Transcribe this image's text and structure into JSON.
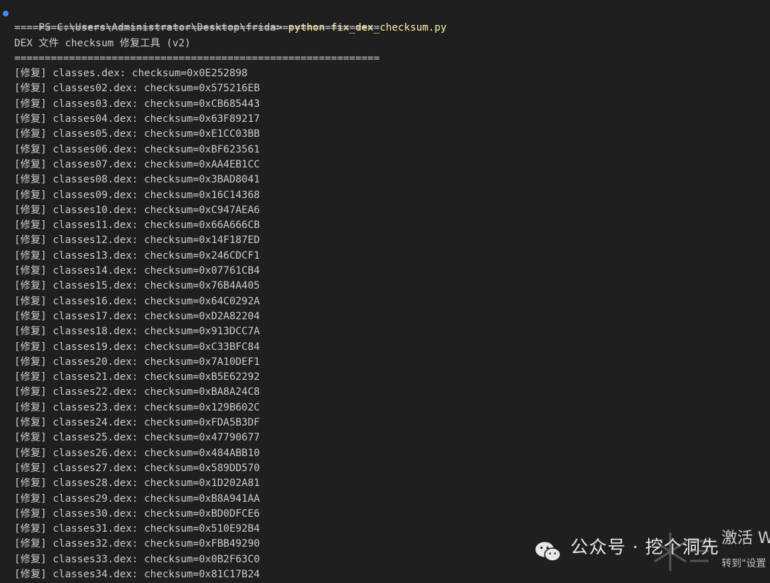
{
  "terminal": {
    "prompt": "PS C:\\Users\\Administrator\\Desktop\\frida> ",
    "command": "python fix_dex_checksum.py",
    "separator": "============================================================",
    "header": "DEX 文件 checksum 修复工具 (v2)",
    "entries": [
      {
        "tag": "[修复]",
        "text": " classes.dex: checksum=0x0E252898"
      },
      {
        "tag": "[修复]",
        "text": " classes02.dex: checksum=0x575216EB"
      },
      {
        "tag": "[修复]",
        "text": " classes03.dex: checksum=0xCB685443"
      },
      {
        "tag": "[修复]",
        "text": " classes04.dex: checksum=0x63F89217"
      },
      {
        "tag": "[修复]",
        "text": " classes05.dex: checksum=0xE1CC03BB"
      },
      {
        "tag": "[修复]",
        "text": " classes06.dex: checksum=0xBF623561"
      },
      {
        "tag": "[修复]",
        "text": " classes07.dex: checksum=0xAA4EB1CC"
      },
      {
        "tag": "[修复]",
        "text": " classes08.dex: checksum=0x3BAD8041"
      },
      {
        "tag": "[修复]",
        "text": " classes09.dex: checksum=0x16C14368"
      },
      {
        "tag": "[修复]",
        "text": " classes10.dex: checksum=0xC947AEA6"
      },
      {
        "tag": "[修复]",
        "text": " classes11.dex: checksum=0x66A666CB"
      },
      {
        "tag": "[修复]",
        "text": " classes12.dex: checksum=0x14F187ED"
      },
      {
        "tag": "[修复]",
        "text": " classes13.dex: checksum=0x246CDCF1"
      },
      {
        "tag": "[修复]",
        "text": " classes14.dex: checksum=0x07761CB4"
      },
      {
        "tag": "[修复]",
        "text": " classes15.dex: checksum=0x76B4A405"
      },
      {
        "tag": "[修复]",
        "text": " classes16.dex: checksum=0x64C0292A"
      },
      {
        "tag": "[修复]",
        "text": " classes17.dex: checksum=0xD2A82204"
      },
      {
        "tag": "[修复]",
        "text": " classes18.dex: checksum=0x913DCC7A"
      },
      {
        "tag": "[修复]",
        "text": " classes19.dex: checksum=0xC33BFC84"
      },
      {
        "tag": "[修复]",
        "text": " classes20.dex: checksum=0x7A10DEF1"
      },
      {
        "tag": "[修复]",
        "text": " classes21.dex: checksum=0xB5E62292"
      },
      {
        "tag": "[修复]",
        "text": " classes22.dex: checksum=0xBA8A24C8"
      },
      {
        "tag": "[修复]",
        "text": " classes23.dex: checksum=0x129B602C"
      },
      {
        "tag": "[修复]",
        "text": " classes24.dex: checksum=0xFDA5B3DF"
      },
      {
        "tag": "[修复]",
        "text": " classes25.dex: checksum=0x47790677"
      },
      {
        "tag": "[修复]",
        "text": " classes26.dex: checksum=0x484ABB10"
      },
      {
        "tag": "[修复]",
        "text": " classes27.dex: checksum=0x589DD570"
      },
      {
        "tag": "[修复]",
        "text": " classes28.dex: checksum=0x1D202A81"
      },
      {
        "tag": "[修复]",
        "text": " classes29.dex: checksum=0xB8A941AA"
      },
      {
        "tag": "[修复]",
        "text": " classes30.dex: checksum=0xBD0DFCE6"
      },
      {
        "tag": "[修复]",
        "text": " classes31.dex: checksum=0x510E92B4"
      },
      {
        "tag": "[修复]",
        "text": " classes32.dex: checksum=0xFBB49290"
      },
      {
        "tag": "[修复]",
        "text": " classes33.dex: checksum=0x0B2F63C0"
      },
      {
        "tag": "[修复]",
        "text": " classes34.dex: checksum=0x81C17B24"
      }
    ]
  },
  "watermark": {
    "account": "公众号 · 挖个洞先",
    "activate": "激活 W",
    "goto_settings": "转到\"设置"
  },
  "colors": {
    "background": "#1f1f1f",
    "foreground": "#cccccc",
    "command": "#f9f1a5",
    "prompt_dot": "#3794ff"
  }
}
